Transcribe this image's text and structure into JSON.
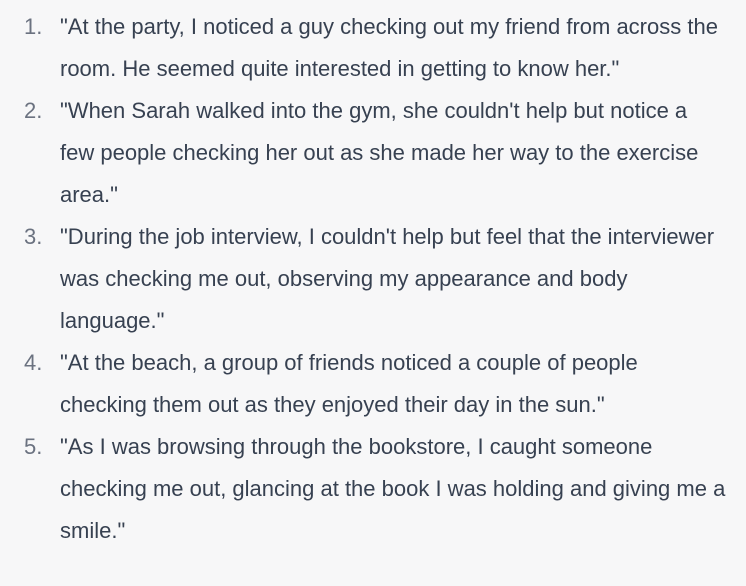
{
  "examples": [
    {
      "number": "1.",
      "text": "\"At the party, I noticed a guy checking out my friend from across the room. He seemed quite interested in getting to know her.\""
    },
    {
      "number": "2.",
      "text": "\"When Sarah walked into the gym, she couldn't help but notice a few people checking her out as she made her way to the exercise area.\""
    },
    {
      "number": "3.",
      "text": "\"During the job interview, I couldn't help but feel that the interviewer was checking me out, observing my appearance and body language.\""
    },
    {
      "number": "4.",
      "text": "\"At the beach, a group of friends noticed a couple of people checking them out as they enjoyed their day in the sun.\""
    },
    {
      "number": "5.",
      "text": "\"As I was browsing through the bookstore, I caught someone checking me out, glancing at the book I was holding and giving me a smile.\""
    }
  ]
}
